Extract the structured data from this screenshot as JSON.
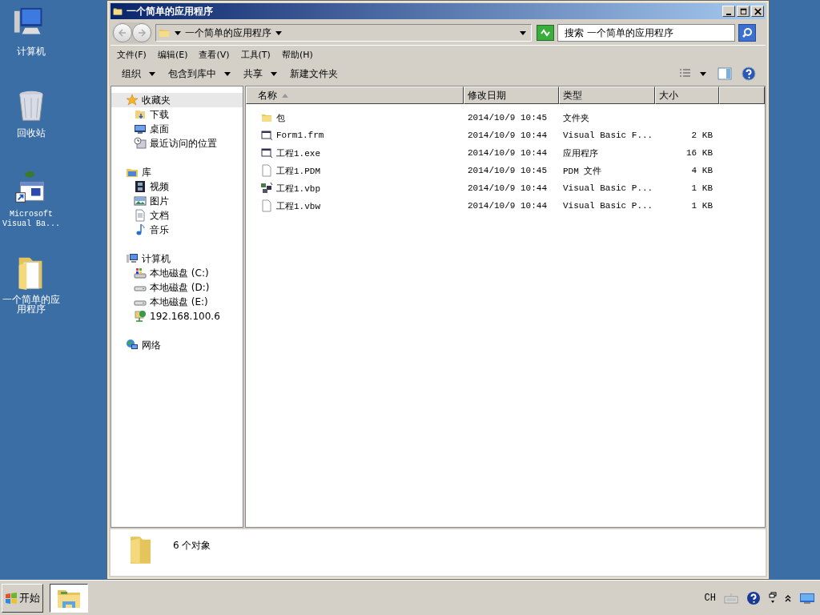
{
  "desktop_icons": [
    {
      "label": "计算机",
      "kind": "computer"
    },
    {
      "label": "回收站",
      "kind": "recycle"
    },
    {
      "label": "Microsoft Visual Ba...",
      "kind": "vb"
    },
    {
      "label": "一个简单的应用程序",
      "kind": "folder"
    }
  ],
  "window": {
    "title": "一个简单的应用程序",
    "address": {
      "path": "一个简单的应用程序"
    },
    "search": {
      "placeholder": "搜索 一个简单的应用程序"
    },
    "menu": [
      "文件(F)",
      "编辑(E)",
      "查看(V)",
      "工具(T)",
      "帮助(H)"
    ],
    "toolbar": [
      {
        "label": "组织",
        "dropdown": true
      },
      {
        "label": "包含到库中",
        "dropdown": true
      },
      {
        "label": "共享",
        "dropdown": true
      },
      {
        "label": "新建文件夹",
        "dropdown": false
      }
    ],
    "nav": [
      {
        "label": "收藏夹",
        "kind": "star",
        "selected": true,
        "children": [
          {
            "label": "下载",
            "kind": "download",
            "selected": false
          },
          {
            "label": "桌面",
            "kind": "desktop",
            "selected": false
          },
          {
            "label": "最近访问的位置",
            "kind": "recent",
            "selected": false
          }
        ]
      },
      {
        "label": "库",
        "kind": "library",
        "selected": false,
        "children": [
          {
            "label": "视频",
            "kind": "video",
            "selected": false
          },
          {
            "label": "图片",
            "kind": "picture",
            "selected": false
          },
          {
            "label": "文档",
            "kind": "document",
            "selected": false
          },
          {
            "label": "音乐",
            "kind": "music",
            "selected": false
          }
        ]
      },
      {
        "label": "计算机",
        "kind": "computer",
        "selected": false,
        "children": [
          {
            "label": "本地磁盘 (C:)",
            "kind": "sysdrive",
            "selected": false
          },
          {
            "label": "本地磁盘 (D:)",
            "kind": "drive",
            "selected": false
          },
          {
            "label": "本地磁盘 (E:)",
            "kind": "drive",
            "selected": false
          },
          {
            "label": "192.168.100.6",
            "kind": "netdrive",
            "selected": false
          }
        ]
      },
      {
        "label": "网络",
        "kind": "network",
        "selected": false
      }
    ],
    "columns": [
      {
        "label": "名称",
        "sorted": true
      },
      {
        "label": "修改日期",
        "sorted": false
      },
      {
        "label": "类型",
        "sorted": false
      },
      {
        "label": "大小",
        "sorted": false
      }
    ],
    "files": [
      {
        "name": "包",
        "date": "2014/10/9 10:45",
        "type": "文件夹",
        "kind": "folder"
      },
      {
        "name": "Form1.frm",
        "date": "2014/10/9 10:44",
        "type": "Visual Basic F...",
        "size": "2 KB",
        "kind": "form"
      },
      {
        "name": "工程1.exe",
        "date": "2014/10/9 10:44",
        "type": "应用程序",
        "size": "16 KB",
        "kind": "form"
      },
      {
        "name": "工程1.PDM",
        "date": "2014/10/9 10:45",
        "type": "PDM 文件",
        "size": "4 KB",
        "kind": "file"
      },
      {
        "name": "工程1.vbp",
        "date": "2014/10/9 10:44",
        "type": "Visual Basic P...",
        "size": "1 KB",
        "kind": "vbp"
      },
      {
        "name": "工程1.vbw",
        "date": "2014/10/9 10:44",
        "type": "Visual Basic P...",
        "size": "1 KB",
        "kind": "file"
      }
    ],
    "status": "6 个对象"
  },
  "taskbar": {
    "start": "开始",
    "apps": [
      {
        "kind": "explorer",
        "active": true
      }
    ],
    "language": "CH"
  }
}
